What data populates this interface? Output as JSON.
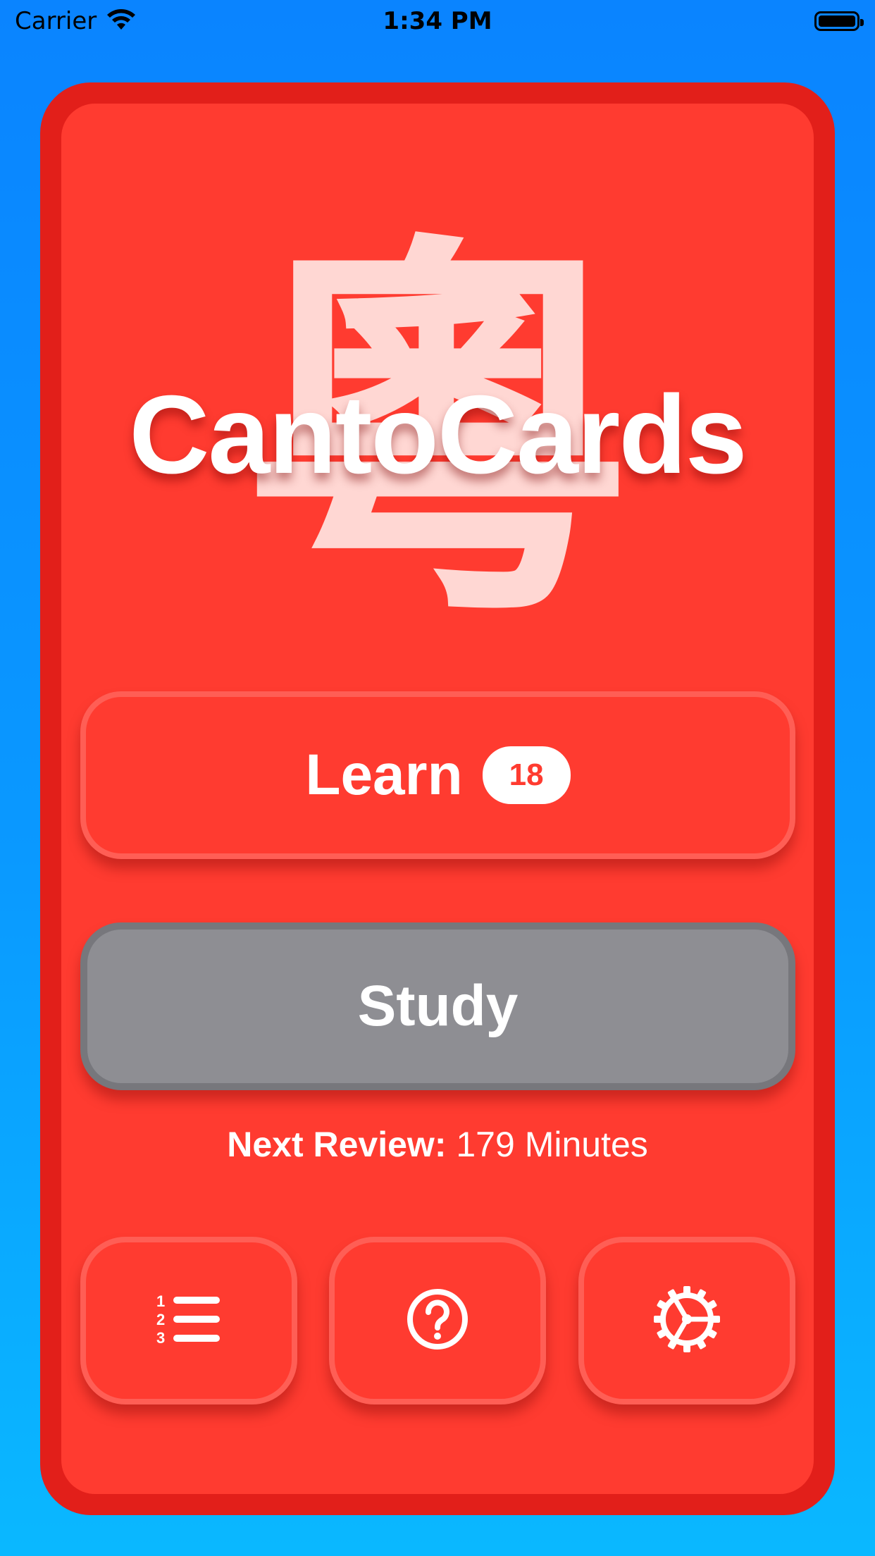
{
  "status_bar": {
    "carrier": "Carrier",
    "time": "1:34 PM",
    "wifi_icon": "wifi-icon",
    "battery_icon": "battery-icon"
  },
  "hero": {
    "hanzi": "粵",
    "app_title": "CantoCards"
  },
  "learn_button": {
    "label": "Learn",
    "badge_count": "18"
  },
  "study_button": {
    "label": "Study"
  },
  "next_review": {
    "label": "Next Review:",
    "value": "179 Minutes"
  },
  "toolbar": {
    "list_icon": "numbered-list-icon",
    "help_icon": "question-circle-icon",
    "settings_icon": "gear-icon"
  },
  "colors": {
    "background_top": "#0a84ff",
    "background_bottom": "#0ab8ff",
    "card_border": "#e21f1a",
    "card_fill": "#ff3b30",
    "study_button": "#8e8e93",
    "hanzi": "#ffd7d3"
  }
}
